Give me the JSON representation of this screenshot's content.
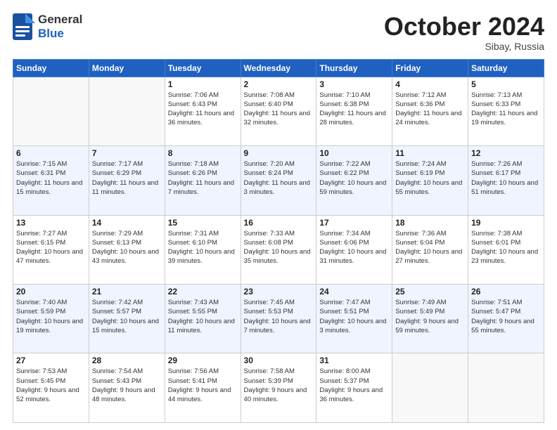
{
  "header": {
    "logo_line1": "General",
    "logo_line2": "Blue",
    "month": "October 2024",
    "location": "Sibay, Russia"
  },
  "days_of_week": [
    "Sunday",
    "Monday",
    "Tuesday",
    "Wednesday",
    "Thursday",
    "Friday",
    "Saturday"
  ],
  "weeks": [
    [
      {
        "num": "",
        "sunrise": "",
        "sunset": "",
        "daylight": ""
      },
      {
        "num": "",
        "sunrise": "",
        "sunset": "",
        "daylight": ""
      },
      {
        "num": "1",
        "sunrise": "Sunrise: 7:06 AM",
        "sunset": "Sunset: 6:43 PM",
        "daylight": "Daylight: 11 hours and 36 minutes."
      },
      {
        "num": "2",
        "sunrise": "Sunrise: 7:08 AM",
        "sunset": "Sunset: 6:40 PM",
        "daylight": "Daylight: 11 hours and 32 minutes."
      },
      {
        "num": "3",
        "sunrise": "Sunrise: 7:10 AM",
        "sunset": "Sunset: 6:38 PM",
        "daylight": "Daylight: 11 hours and 28 minutes."
      },
      {
        "num": "4",
        "sunrise": "Sunrise: 7:12 AM",
        "sunset": "Sunset: 6:36 PM",
        "daylight": "Daylight: 11 hours and 24 minutes."
      },
      {
        "num": "5",
        "sunrise": "Sunrise: 7:13 AM",
        "sunset": "Sunset: 6:33 PM",
        "daylight": "Daylight: 11 hours and 19 minutes."
      }
    ],
    [
      {
        "num": "6",
        "sunrise": "Sunrise: 7:15 AM",
        "sunset": "Sunset: 6:31 PM",
        "daylight": "Daylight: 11 hours and 15 minutes."
      },
      {
        "num": "7",
        "sunrise": "Sunrise: 7:17 AM",
        "sunset": "Sunset: 6:29 PM",
        "daylight": "Daylight: 11 hours and 11 minutes."
      },
      {
        "num": "8",
        "sunrise": "Sunrise: 7:18 AM",
        "sunset": "Sunset: 6:26 PM",
        "daylight": "Daylight: 11 hours and 7 minutes."
      },
      {
        "num": "9",
        "sunrise": "Sunrise: 7:20 AM",
        "sunset": "Sunset: 6:24 PM",
        "daylight": "Daylight: 11 hours and 3 minutes."
      },
      {
        "num": "10",
        "sunrise": "Sunrise: 7:22 AM",
        "sunset": "Sunset: 6:22 PM",
        "daylight": "Daylight: 10 hours and 59 minutes."
      },
      {
        "num": "11",
        "sunrise": "Sunrise: 7:24 AM",
        "sunset": "Sunset: 6:19 PM",
        "daylight": "Daylight: 10 hours and 55 minutes."
      },
      {
        "num": "12",
        "sunrise": "Sunrise: 7:26 AM",
        "sunset": "Sunset: 6:17 PM",
        "daylight": "Daylight: 10 hours and 51 minutes."
      }
    ],
    [
      {
        "num": "13",
        "sunrise": "Sunrise: 7:27 AM",
        "sunset": "Sunset: 6:15 PM",
        "daylight": "Daylight: 10 hours and 47 minutes."
      },
      {
        "num": "14",
        "sunrise": "Sunrise: 7:29 AM",
        "sunset": "Sunset: 6:13 PM",
        "daylight": "Daylight: 10 hours and 43 minutes."
      },
      {
        "num": "15",
        "sunrise": "Sunrise: 7:31 AM",
        "sunset": "Sunset: 6:10 PM",
        "daylight": "Daylight: 10 hours and 39 minutes."
      },
      {
        "num": "16",
        "sunrise": "Sunrise: 7:33 AM",
        "sunset": "Sunset: 6:08 PM",
        "daylight": "Daylight: 10 hours and 35 minutes."
      },
      {
        "num": "17",
        "sunrise": "Sunrise: 7:34 AM",
        "sunset": "Sunset: 6:06 PM",
        "daylight": "Daylight: 10 hours and 31 minutes."
      },
      {
        "num": "18",
        "sunrise": "Sunrise: 7:36 AM",
        "sunset": "Sunset: 6:04 PM",
        "daylight": "Daylight: 10 hours and 27 minutes."
      },
      {
        "num": "19",
        "sunrise": "Sunrise: 7:38 AM",
        "sunset": "Sunset: 6:01 PM",
        "daylight": "Daylight: 10 hours and 23 minutes."
      }
    ],
    [
      {
        "num": "20",
        "sunrise": "Sunrise: 7:40 AM",
        "sunset": "Sunset: 5:59 PM",
        "daylight": "Daylight: 10 hours and 19 minutes."
      },
      {
        "num": "21",
        "sunrise": "Sunrise: 7:42 AM",
        "sunset": "Sunset: 5:57 PM",
        "daylight": "Daylight: 10 hours and 15 minutes."
      },
      {
        "num": "22",
        "sunrise": "Sunrise: 7:43 AM",
        "sunset": "Sunset: 5:55 PM",
        "daylight": "Daylight: 10 hours and 11 minutes."
      },
      {
        "num": "23",
        "sunrise": "Sunrise: 7:45 AM",
        "sunset": "Sunset: 5:53 PM",
        "daylight": "Daylight: 10 hours and 7 minutes."
      },
      {
        "num": "24",
        "sunrise": "Sunrise: 7:47 AM",
        "sunset": "Sunset: 5:51 PM",
        "daylight": "Daylight: 10 hours and 3 minutes."
      },
      {
        "num": "25",
        "sunrise": "Sunrise: 7:49 AM",
        "sunset": "Sunset: 5:49 PM",
        "daylight": "Daylight: 9 hours and 59 minutes."
      },
      {
        "num": "26",
        "sunrise": "Sunrise: 7:51 AM",
        "sunset": "Sunset: 5:47 PM",
        "daylight": "Daylight: 9 hours and 55 minutes."
      }
    ],
    [
      {
        "num": "27",
        "sunrise": "Sunrise: 7:53 AM",
        "sunset": "Sunset: 5:45 PM",
        "daylight": "Daylight: 9 hours and 52 minutes."
      },
      {
        "num": "28",
        "sunrise": "Sunrise: 7:54 AM",
        "sunset": "Sunset: 5:43 PM",
        "daylight": "Daylight: 9 hours and 48 minutes."
      },
      {
        "num": "29",
        "sunrise": "Sunrise: 7:56 AM",
        "sunset": "Sunset: 5:41 PM",
        "daylight": "Daylight: 9 hours and 44 minutes."
      },
      {
        "num": "30",
        "sunrise": "Sunrise: 7:58 AM",
        "sunset": "Sunset: 5:39 PM",
        "daylight": "Daylight: 9 hours and 40 minutes."
      },
      {
        "num": "31",
        "sunrise": "Sunrise: 8:00 AM",
        "sunset": "Sunset: 5:37 PM",
        "daylight": "Daylight: 9 hours and 36 minutes."
      },
      {
        "num": "",
        "sunrise": "",
        "sunset": "",
        "daylight": ""
      },
      {
        "num": "",
        "sunrise": "",
        "sunset": "",
        "daylight": ""
      }
    ]
  ]
}
